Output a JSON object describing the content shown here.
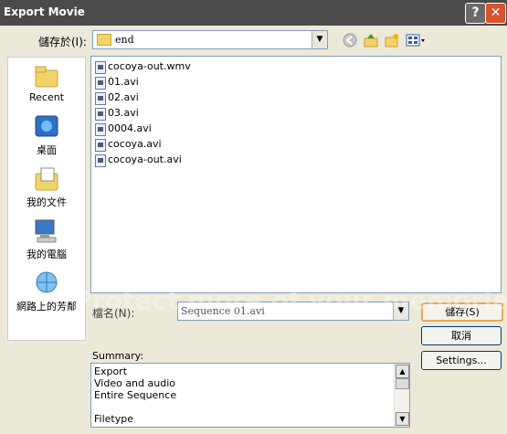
{
  "window": {
    "title": "Export Movie",
    "help_label": "?",
    "close_label": "✕"
  },
  "toolbar": {
    "lookin_label": "儲存於(I):",
    "lookin_value": "end",
    "arrow": "▼",
    "icons": [
      "back-icon",
      "up-folder-icon",
      "new-folder-icon",
      "view-menu-icon"
    ]
  },
  "places": [
    {
      "label": "Recent",
      "icon": "recent-icon"
    },
    {
      "label": "桌面",
      "icon": "desktop-icon"
    },
    {
      "label": "我的文件",
      "icon": "my-documents-icon"
    },
    {
      "label": "我的電腦",
      "icon": "my-computer-icon"
    },
    {
      "label": "網路上的芳鄰",
      "icon": "network-icon"
    }
  ],
  "files": [
    "cocoya-out.wmv",
    "01.avi",
    "02.avi",
    "03.avi",
    "0004.avi",
    "cocoya.avi",
    "cocoya-out.avi"
  ],
  "filename": {
    "label": "檔名(N):",
    "value": "Sequence 01.avi"
  },
  "buttons": {
    "save": "儲存(S)",
    "cancel": "取消",
    "settings": "Settings..."
  },
  "summary": {
    "label": "Summary:",
    "lines": [
      "Export",
      " Video and audio",
      " Entire Sequence",
      "",
      "Filetype"
    ]
  },
  "watermark": "Protect more of your memories for less!"
}
